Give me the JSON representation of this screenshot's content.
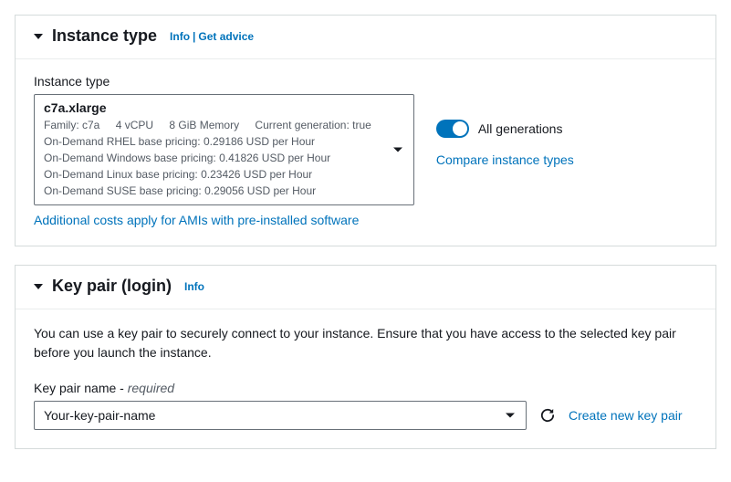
{
  "instanceTypePanel": {
    "title": "Instance type",
    "infoLabel": "Info",
    "getAdviceLabel": "Get advice",
    "fieldLabel": "Instance type",
    "selected": {
      "name": "c7a.xlarge",
      "family": "Family: c7a",
      "vcpu": "4 vCPU",
      "memory": "8 GiB Memory",
      "currentGen": "Current generation: true",
      "rhel": "On-Demand RHEL base pricing: 0.29186 USD per Hour",
      "windows": "On-Demand Windows base pricing: 0.41826 USD per Hour",
      "linux": "On-Demand Linux base pricing: 0.23426 USD per Hour",
      "suse": "On-Demand SUSE base pricing: 0.29056 USD per Hour"
    },
    "allGenerationsLabel": "All generations",
    "compareLink": "Compare instance types",
    "additionalCostsLink": "Additional costs apply for AMIs with pre-installed software"
  },
  "keyPairPanel": {
    "title": "Key pair (login)",
    "infoLabel": "Info",
    "description": "You can use a key pair to securely connect to your instance. Ensure that you have access to the selected key pair before you launch the instance.",
    "fieldLabel": "Key pair name - ",
    "requiredLabel": "required",
    "selectedValue": "Your-key-pair-name",
    "createNewLink": "Create new key pair"
  }
}
